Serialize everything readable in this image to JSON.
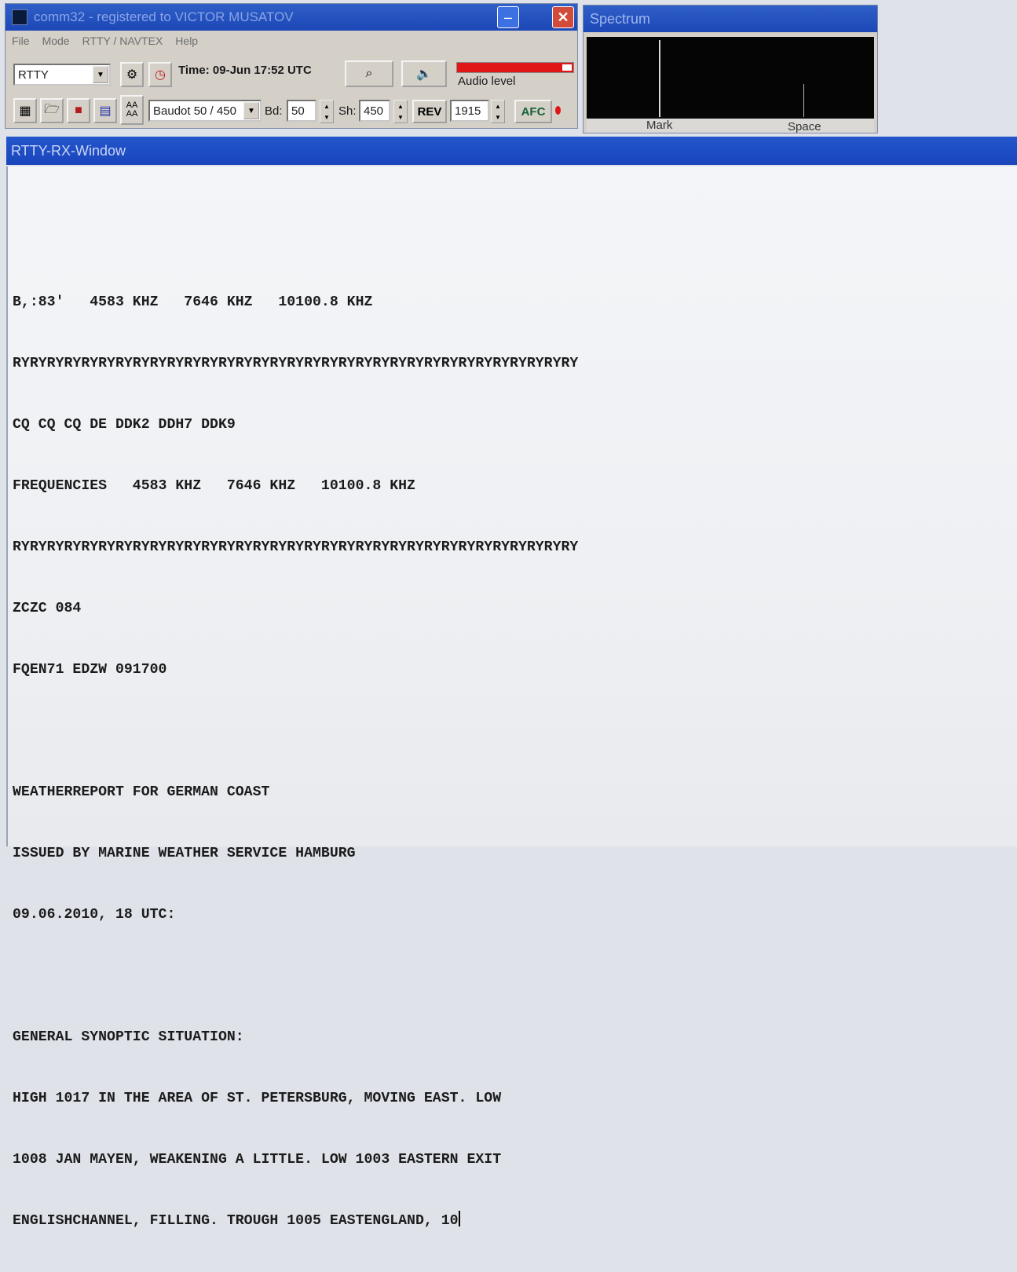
{
  "main_window": {
    "title": "comm32 - registered to VICTOR MUSATOV",
    "minimize_glyph": "–",
    "close_glyph": "✕",
    "menu": [
      "File",
      "Mode",
      "RTTY / NAVTEX",
      "Help"
    ],
    "mode_select": "RTTY",
    "time_label": "Time: 09-Jun 17:52 UTC",
    "audio_level_label": "Audio level",
    "audio_level_fraction": 0.92,
    "baud_select": "Baudot 50 / 450",
    "bd_label": "Bd:",
    "bd_value": "50",
    "sh_label": "Sh:",
    "sh_value": "450",
    "rev_label": "REV",
    "freq_value": "1915",
    "afc_label": "AFC",
    "indicator_color": "#e01515",
    "icons": [
      "settings-icon",
      "clock-icon",
      "tuning-icon",
      "speaker-icon",
      "grid-icon",
      "folder-icon",
      "save-icon",
      "chart-icon",
      "text-size-icon"
    ]
  },
  "spectrum": {
    "title": "Spectrum",
    "mark_label": "Mark",
    "space_label": "Space"
  },
  "rx_window": {
    "title": "RTTY-RX-Window",
    "lines": [
      "",
      "B,:83'   4583 KHZ   7646 KHZ   10100.8 KHZ",
      "RYRYRYRYRYRYRYRYRYRYRYRYRYRYRYRYRYRYRYRYRYRYRYRYRYRYRYRYRYRYRYRYRY",
      "CQ CQ CQ DE DDK2 DDH7 DDK9",
      "FREQUENCIES   4583 KHZ   7646 KHZ   10100.8 KHZ",
      "RYRYRYRYRYRYRYRYRYRYRYRYRYRYRYRYRYRYRYRYRYRYRYRYRYRYRYRYRYRYRYRYRY",
      "ZCZC 084",
      "FQEN71 EDZW 091700",
      "",
      "WEATHERREPORT FOR GERMAN COAST",
      "ISSUED BY MARINE WEATHER SERVICE HAMBURG",
      "09.06.2010, 18 UTC:",
      "",
      "GENERAL SYNOPTIC SITUATION:",
      "HIGH 1017 IN THE AREA OF ST. PETERSBURG, MOVING EAST. LOW",
      "1008 JAN MAYEN, WEAKENING A LITTLE. LOW 1003 EASTERN EXIT",
      "ENGLISHCHANNEL, FILLING. TROUGH 1005 EASTENGLAND, 10"
    ]
  }
}
